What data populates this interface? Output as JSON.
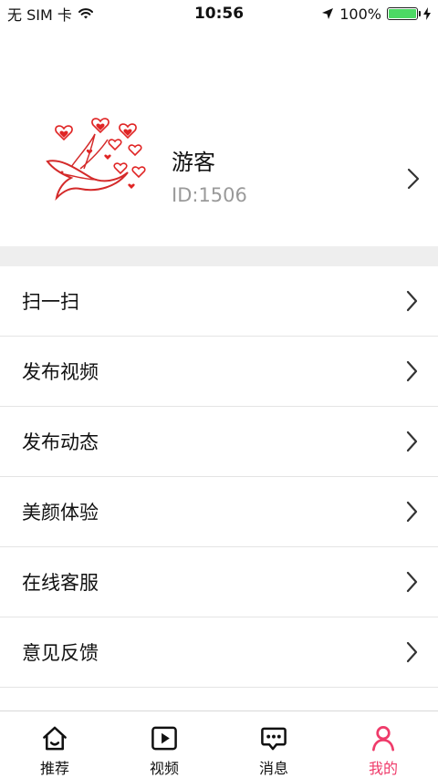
{
  "status_bar": {
    "carrier": "无 SIM 卡",
    "time": "10:56",
    "battery": "100%"
  },
  "profile": {
    "name": "游客",
    "id": "ID:1506"
  },
  "menu": [
    {
      "label": "扫一扫"
    },
    {
      "label": "发布视频"
    },
    {
      "label": "发布动态"
    },
    {
      "label": "美颜体验"
    },
    {
      "label": "在线客服"
    },
    {
      "label": "意见反馈"
    }
  ],
  "tabs": [
    {
      "label": "推荐",
      "icon": "home-icon"
    },
    {
      "label": "视频",
      "icon": "video-play-icon"
    },
    {
      "label": "消息",
      "icon": "message-icon"
    },
    {
      "label": "我的",
      "icon": "user-icon",
      "active": true
    }
  ],
  "colors": {
    "accent": "#ef3b6a",
    "battery": "#4cd964",
    "divider": "#eeeeee"
  }
}
